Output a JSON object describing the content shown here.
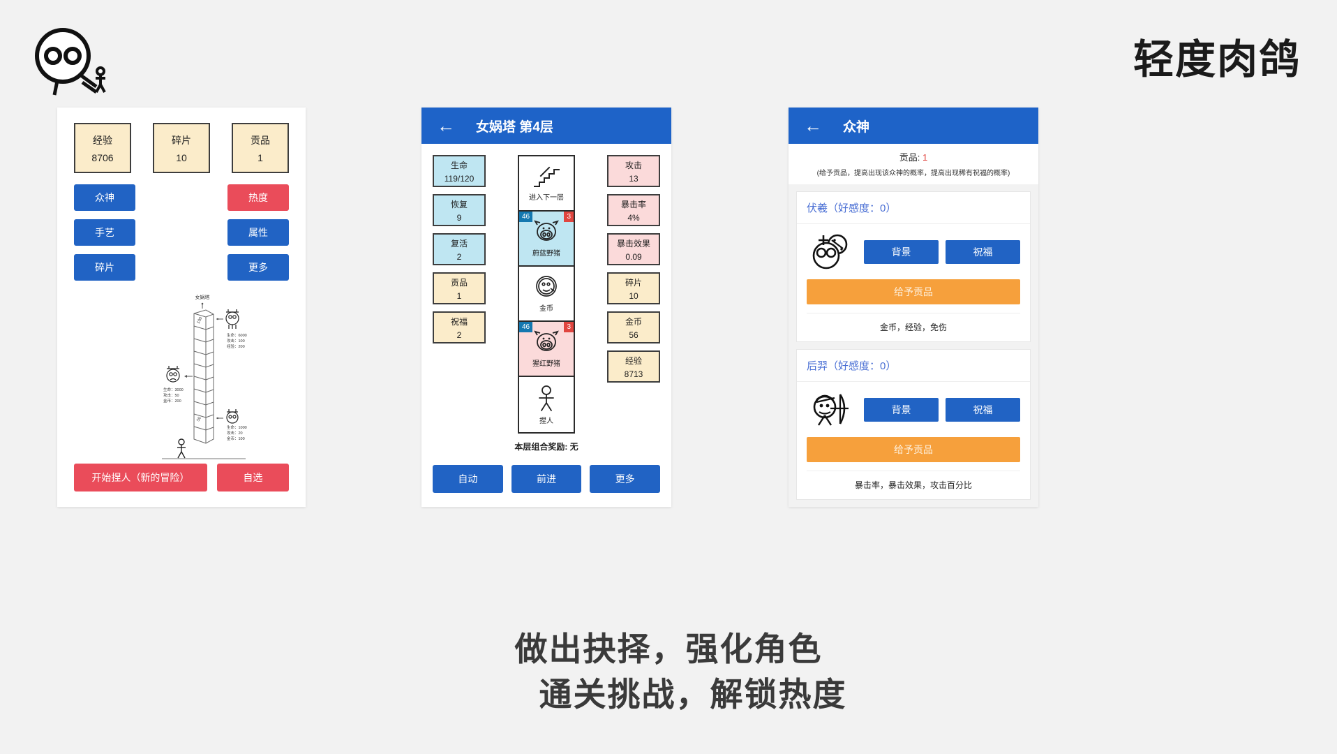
{
  "brand": {
    "title": "轻度肉鸽",
    "logo_icon": "alien-face-logo-icon"
  },
  "caption": {
    "line1": "做出抉择，强化角色",
    "line2": "通关挑战，解锁热度"
  },
  "home": {
    "stats": [
      {
        "label": "经验",
        "value": "8706"
      },
      {
        "label": "碎片",
        "value": "10"
      },
      {
        "label": "贡品",
        "value": "1"
      }
    ],
    "buttons": [
      {
        "label": "众神",
        "color": "blue"
      },
      {
        "label": "热度",
        "color": "red"
      },
      {
        "label": "手艺",
        "color": "blue"
      },
      {
        "label": "属性",
        "color": "blue"
      },
      {
        "label": "碎片",
        "color": "blue"
      },
      {
        "label": "更多",
        "color": "blue"
      }
    ],
    "tower": {
      "top_label": "女娲塔",
      "floor_labels": [
        "100",
        "50"
      ],
      "enemies": [
        {
          "stats": [
            "生命：6000",
            "攻击：100",
            "经验：200"
          ]
        },
        {
          "stats": [
            "生命：3000",
            "攻击：50",
            "金币：200"
          ]
        },
        {
          "stats": [
            "生命：1000",
            "攻击：20",
            "金币：100"
          ]
        }
      ]
    },
    "bottom_buttons": [
      {
        "label": "开始捏人（新的冒险）"
      },
      {
        "label": "自选"
      }
    ]
  },
  "floor": {
    "appbar": {
      "back_icon": "back-arrow-icon",
      "title": "女娲塔 第4层"
    },
    "left_stats": [
      {
        "label": "生命",
        "value": "119/120",
        "tone": "cyan"
      },
      {
        "label": "恢复",
        "value": "9",
        "tone": "cyan"
      },
      {
        "label": "复活",
        "value": "2",
        "tone": "cyan"
      },
      {
        "label": "贡品",
        "value": "1",
        "tone": "cream"
      },
      {
        "label": "祝福",
        "value": "2",
        "tone": "cream"
      }
    ],
    "right_stats": [
      {
        "label": "攻击",
        "value": "13",
        "tone": "pink"
      },
      {
        "label": "暴击率",
        "value": "4%",
        "tone": "pink"
      },
      {
        "label": "暴击效果",
        "value": "0.09",
        "tone": "pink"
      },
      {
        "label": "碎片",
        "value": "10",
        "tone": "cream"
      },
      {
        "label": "金币",
        "value": "56",
        "tone": "cream"
      },
      {
        "label": "经验",
        "value": "8713",
        "tone": "cream"
      }
    ],
    "cards": [
      {
        "name": "进入下一层",
        "icon": "stairs-up-icon",
        "tone": "white",
        "hp": "",
        "atk": ""
      },
      {
        "name": "蔚蓝野猪",
        "icon": "pig-face-icon",
        "tone": "cyan",
        "hp": "46",
        "atk": "3"
      },
      {
        "name": "金币",
        "icon": "coin-icon",
        "tone": "white",
        "hp": "",
        "atk": ""
      },
      {
        "name": "猩红野猪",
        "icon": "pig-face-icon",
        "tone": "pink",
        "hp": "46",
        "atk": "3"
      },
      {
        "name": "捏人",
        "icon": "stick-figure-icon",
        "tone": "white",
        "hp": "",
        "atk": ""
      }
    ],
    "combo_note": "本层组合奖励: 无",
    "buttons": [
      {
        "label": "自动"
      },
      {
        "label": "前进"
      },
      {
        "label": "更多"
      }
    ]
  },
  "gods": {
    "appbar": {
      "back_icon": "back-arrow-icon",
      "title": "众神"
    },
    "tribute_label": "贡品:",
    "tribute_value": "1",
    "tribute_hint": "(给予贡品，提高出现该众神的概率，提高出现稀有祝福的概率)",
    "cards": [
      {
        "title": "伏羲（好感度：0）",
        "avatar_icon": "fuxi-avatar-icon",
        "buttons": [
          {
            "label": "背景"
          },
          {
            "label": "祝福"
          }
        ],
        "tribute_button": "给予贡品",
        "footer": "金币，经验，免伤"
      },
      {
        "title": "后羿（好感度：0）",
        "avatar_icon": "houyi-archer-avatar-icon",
        "buttons": [
          {
            "label": "背景"
          },
          {
            "label": "祝福"
          }
        ],
        "tribute_button": "给予贡品",
        "footer": "暴击率，暴击效果，攻击百分比"
      }
    ]
  },
  "colors": {
    "primary_blue": "#2163c4",
    "appbar_blue": "#1e63c8",
    "red": "#ea4c5a",
    "orange": "#f6a03c",
    "cream": "#fbecca",
    "cyan": "#bfe6f2",
    "pink": "#fbdada",
    "god_title": "#4a6fd4"
  }
}
